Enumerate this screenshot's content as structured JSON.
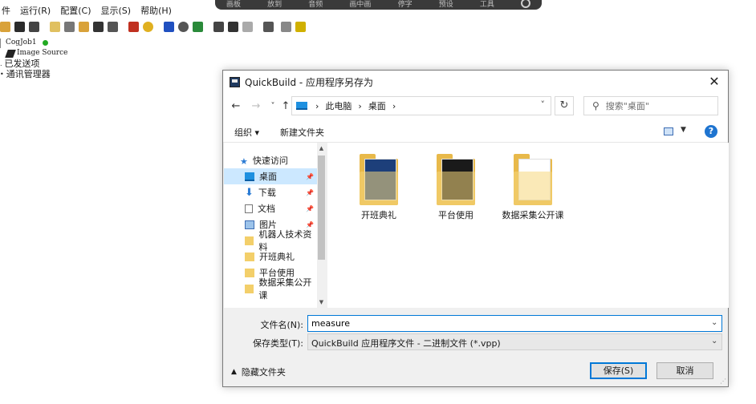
{
  "menu": [
    "运行(R)",
    "配置(C)",
    "显示(S)",
    "帮助(H)"
  ],
  "menu_partial": "件",
  "floatbar": {
    "items": [
      "画板",
      "放到",
      "音频",
      "画中画",
      "停字",
      "预设",
      "工具"
    ]
  },
  "tree": {
    "job": "CogJob1",
    "image_source": "Image Source",
    "sent": "已发送项",
    "comm": "通讯管理器"
  },
  "dialog": {
    "title": "QuickBuild - 应用程序另存为",
    "close": "✕",
    "nav": {
      "back": "←",
      "forward": "→",
      "recent": "˅",
      "up": "↑"
    },
    "address": {
      "crumbs": [
        "此电脑",
        "桌面"
      ],
      "sep": "›",
      "dropdown": "˅"
    },
    "refresh": "↻",
    "search_placeholder": "搜索\"桌面\"",
    "commands": {
      "organize": "组织 ▾",
      "new_folder": "新建文件夹",
      "help": "?"
    },
    "sidebar": [
      {
        "label": "快速访问",
        "icon": "star-icon"
      },
      {
        "label": "桌面",
        "icon": "desktop-icon",
        "selected": true,
        "pinned": true
      },
      {
        "label": "下载",
        "icon": "download-icon",
        "pinned": true
      },
      {
        "label": "文档",
        "icon": "document-icon",
        "pinned": true
      },
      {
        "label": "图片",
        "icon": "picture-icon",
        "pinned": true
      },
      {
        "label": "机器人技术资料",
        "icon": "folder-icon"
      },
      {
        "label": "开班典礼",
        "icon": "folder-icon"
      },
      {
        "label": "平台使用",
        "icon": "folder-icon"
      },
      {
        "label": "数据采集公开课",
        "icon": "folder-icon"
      }
    ],
    "files": [
      {
        "name": "开班典礼",
        "style": "blue"
      },
      {
        "name": "平台使用",
        "style": "dark"
      },
      {
        "name": "数据采集公开课",
        "style": "doc"
      }
    ],
    "filename_label": "文件名(N):",
    "filename_value": "measure",
    "filetype_label": "保存类型(T):",
    "filetype_value": "QuickBuild 应用程序文件 - 二进制文件 (*.vpp)",
    "hide_folders": "隐藏文件夹",
    "save": "保存(S)",
    "cancel": "取消"
  },
  "colors": {
    "accent": "#0078d7",
    "selected": "#cce8ff",
    "folder": "#e8b94a",
    "status_dot": "#22aa22"
  }
}
